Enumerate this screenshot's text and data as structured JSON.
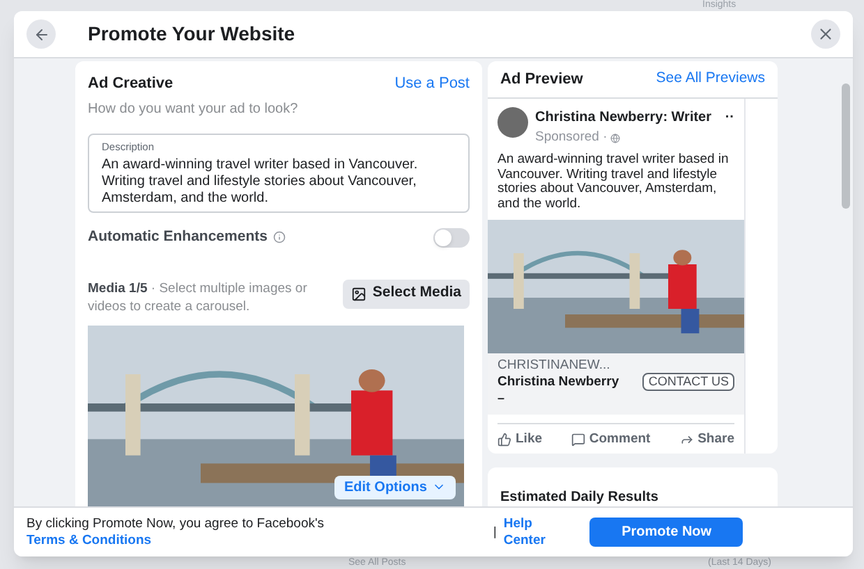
{
  "background": {
    "texts": [
      "Insights",
      "See All Posts",
      "(Last 14 Days)"
    ]
  },
  "window": {
    "title": "Promote Your Website"
  },
  "ad_creative": {
    "title": "Ad Creative",
    "link": "Use a Post",
    "subtitle": "How do you want your ad to look?",
    "description": {
      "label": "Description",
      "value": "An award-winning travel writer based in Vancouver. Writing travel and lifestyle stories about Vancouver, Amsterdam, and the world."
    },
    "automatic_enhancements": {
      "label": "Automatic Enhancements",
      "on": false
    },
    "media": {
      "title": "Media 1/5",
      "hint": "· Select multiple images or videos to create a carousel.",
      "button": "Select Media"
    },
    "edit_options": "Edit Options"
  },
  "ad_preview": {
    "title": "Ad Preview",
    "link": "See All Previews",
    "post": {
      "author": "Christina Newberry: Writer",
      "sponsored": "Sponsored ·",
      "more": "··",
      "text": "An award-winning travel writer based in Vancouver. Writing travel and lifestyle stories about Vancouver, Amsterdam, and the world.",
      "link_domain": "CHRISTINANEW...",
      "link_title": "Christina Newberry",
      "link_extra": "–",
      "cta": "CONTACT US",
      "actions": [
        "Like",
        "Comment",
        "Share"
      ]
    }
  },
  "estimated": {
    "title": "Estimated Daily Results"
  },
  "footer": {
    "text": "By clicking Promote Now, you agree to Facebook's",
    "terms": "Terms & Conditions",
    "separator": "|",
    "help": "Help Center",
    "button": "Promote Now"
  }
}
